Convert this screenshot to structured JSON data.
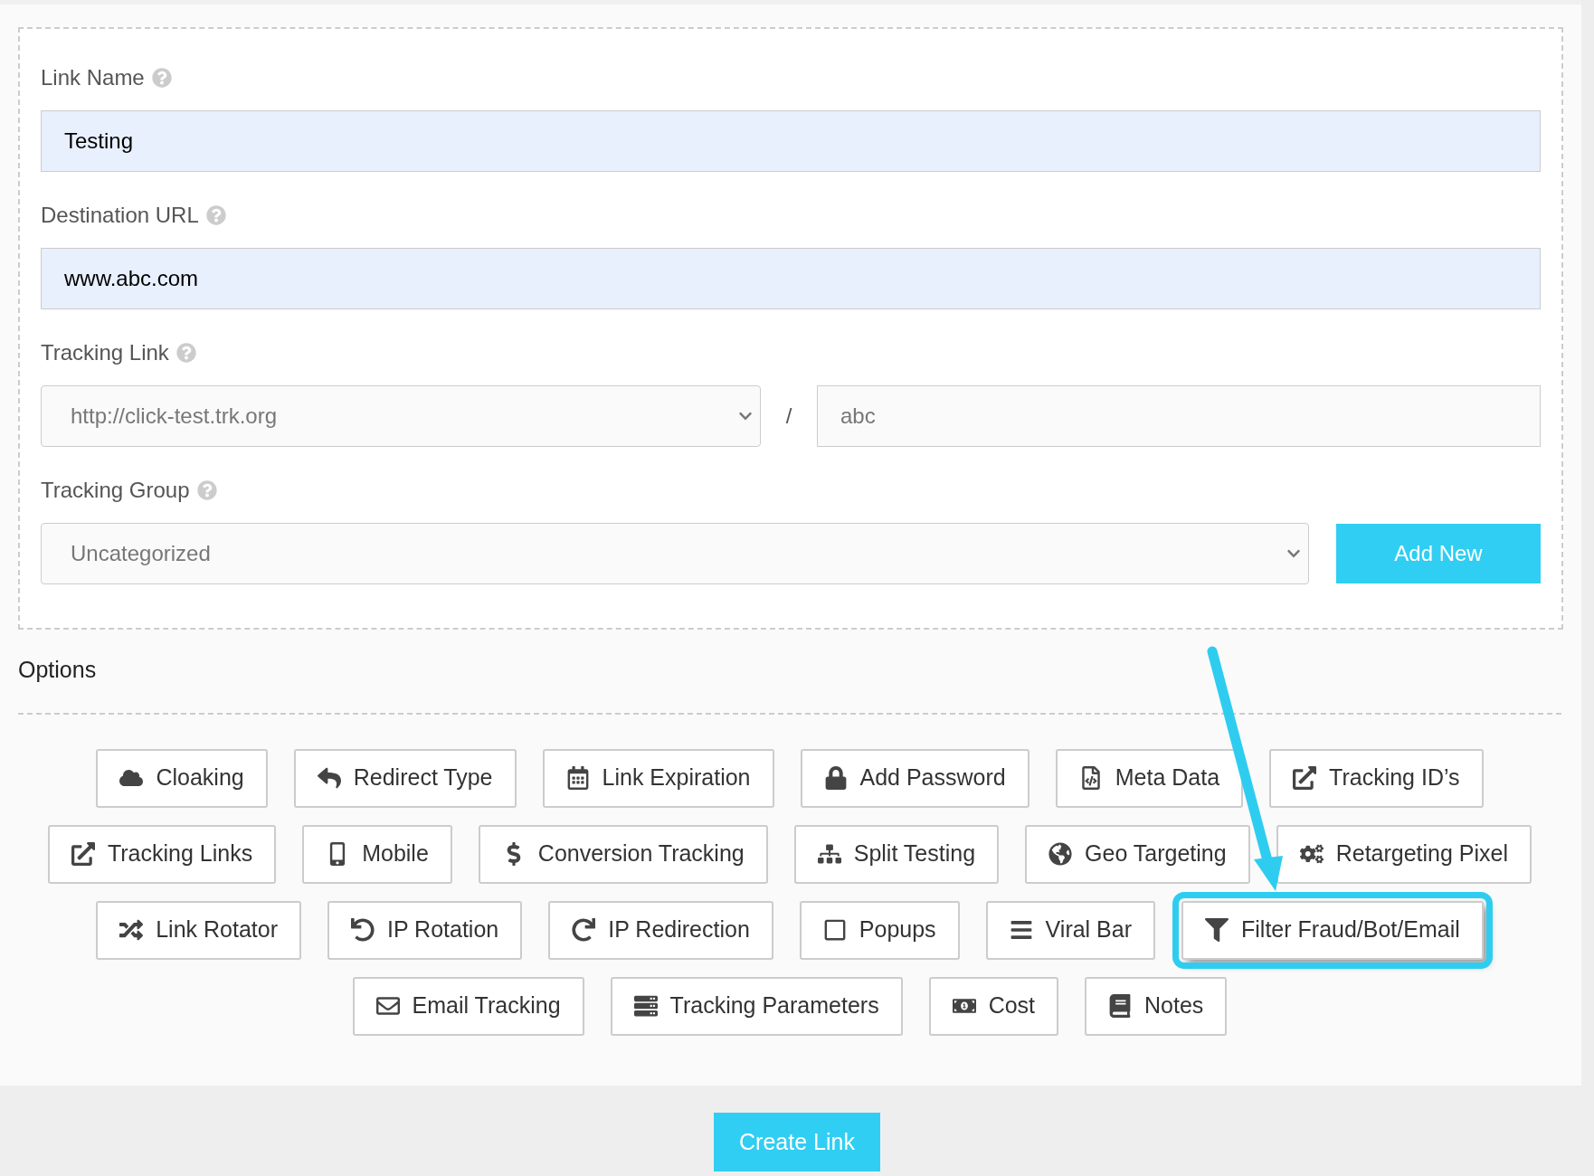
{
  "link_name": {
    "label": "Link Name",
    "value": "Testing"
  },
  "destination_url": {
    "label": "Destination URL",
    "value": "www.abc.com"
  },
  "tracking_link": {
    "label": "Tracking Link",
    "domain": "http://click-test.trk.org",
    "separator": "/",
    "slug": "abc"
  },
  "tracking_group": {
    "label": "Tracking Group",
    "value": "Uncategorized",
    "add_button": "Add New"
  },
  "options": {
    "title": "Options",
    "lines": [
      {
        "buttons": [
          {
            "label": "Cloaking",
            "highlighted": false
          },
          {
            "label": "Redirect Type",
            "highlighted": false
          },
          {
            "label": "Link Expiration",
            "highlighted": false
          },
          {
            "label": "Add Password",
            "highlighted": false
          },
          {
            "label": "Meta Data",
            "highlighted": false
          },
          {
            "label": "Tracking ID’s",
            "highlighted": false
          }
        ]
      },
      {
        "buttons": [
          {
            "label": "Tracking Links",
            "highlighted": false
          },
          {
            "label": "Mobile",
            "highlighted": false
          },
          {
            "label": "Conversion Tracking",
            "highlighted": false
          },
          {
            "label": "Split Testing",
            "highlighted": false
          },
          {
            "label": "Geo Targeting",
            "highlighted": false
          },
          {
            "label": "Retargeting Pixel",
            "highlighted": false
          }
        ]
      },
      {
        "buttons": [
          {
            "label": "Link Rotator",
            "highlighted": false
          },
          {
            "label": "IP Rotation",
            "highlighted": false
          },
          {
            "label": "IP Redirection",
            "highlighted": false
          },
          {
            "label": "Popups",
            "highlighted": false
          },
          {
            "label": "Viral Bar",
            "highlighted": false
          },
          {
            "label": "Filter Fraud/Bot/Email",
            "highlighted": true
          }
        ]
      },
      {
        "buttons": [
          {
            "label": "Email Tracking",
            "highlighted": false
          },
          {
            "label": "Tracking Parameters",
            "highlighted": false
          },
          {
            "label": "Cost",
            "highlighted": false
          },
          {
            "label": "Notes",
            "highlighted": false
          }
        ]
      }
    ]
  },
  "create_button": "Create Link"
}
